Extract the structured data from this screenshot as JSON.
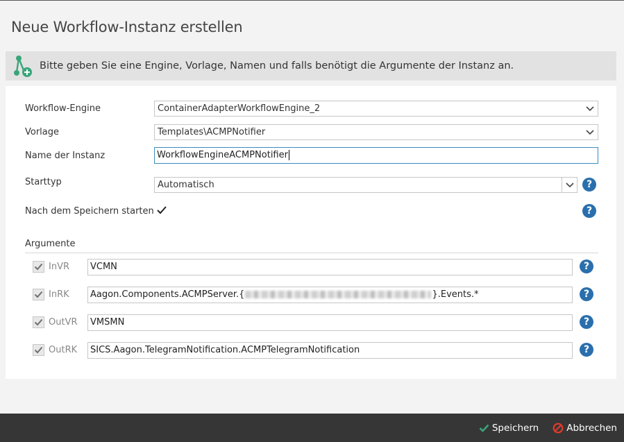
{
  "dialog": {
    "title": "Neue Workflow-Instanz erstellen",
    "info_text": "Bitte geben Sie eine Engine, Vorlage, Namen und falls benötigt die Argumente der Instanz an."
  },
  "form": {
    "engine": {
      "label": "Workflow-Engine",
      "value": "ContainerAdapterWorkflowEngine_2"
    },
    "template": {
      "label": "Vorlage",
      "value": "Templates\\ACMPNotifier"
    },
    "name": {
      "label": "Name der Instanz",
      "value": "WorkflowEngineACMPNotifier"
    },
    "start_type": {
      "label": "Starttyp",
      "value": "Automatisch"
    },
    "start_after_save": {
      "label": "Nach dem Speichern starten",
      "checked": true
    }
  },
  "arguments": {
    "section_label": "Argumente",
    "items": [
      {
        "name": "InVR",
        "value": "VCMN"
      },
      {
        "name": "InRK",
        "value_prefix": "Aagon.Components.ACMPServer.{",
        "value_suffix": "}.Events.*"
      },
      {
        "name": "OutVR",
        "value": "VMSMN"
      },
      {
        "name": "OutRK",
        "value": "SICS.Aagon.TelegramNotification.ACMPTelegramNotification"
      }
    ]
  },
  "help_glyph": "?",
  "footer": {
    "save_label": "Speichern",
    "cancel_label": "Abbrechen"
  },
  "colors": {
    "accent_green": "#3aa57a",
    "help_blue": "#2a6fad",
    "cancel_red": "#e03b2c",
    "footer_bg": "#363636"
  },
  "icons": {
    "workflow_add": "workflow-add-icon",
    "help": "help-icon",
    "check": "checkmark-icon",
    "chevron": "chevron-down-icon",
    "save": "checkmark-icon",
    "cancel": "cancel-icon"
  }
}
